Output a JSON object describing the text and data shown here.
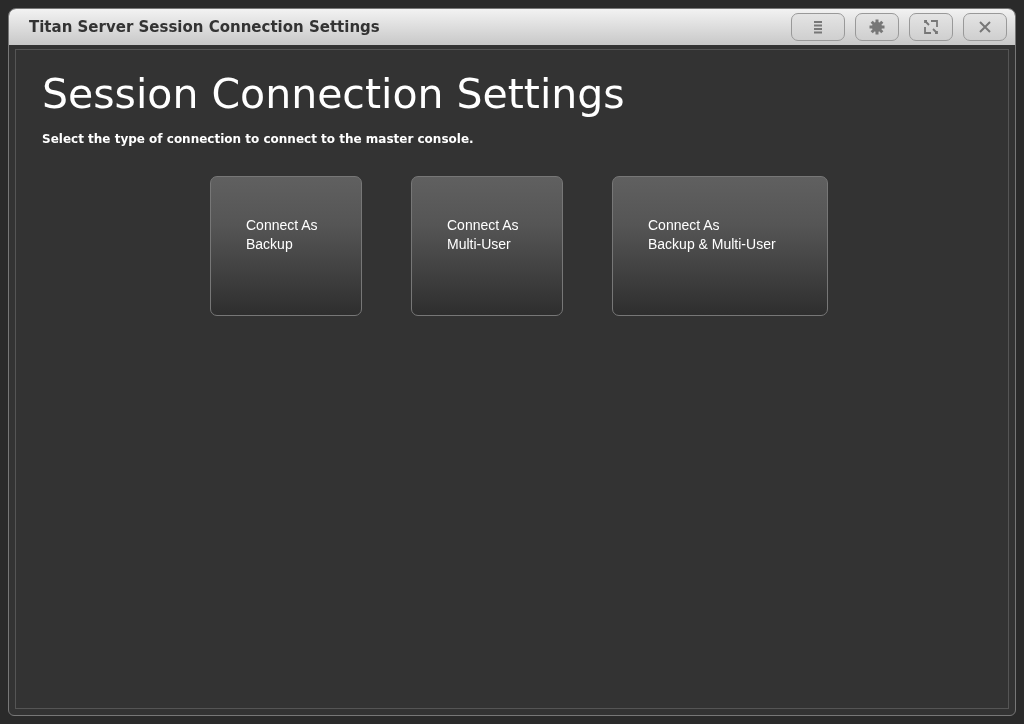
{
  "window": {
    "title": "Titan Server Session Connection Settings"
  },
  "heading": "Session Connection Settings",
  "instruction": "Select the type of connection to connect to the master console.",
  "buttons": [
    {
      "lines": [
        "Connect As",
        "Backup"
      ]
    },
    {
      "lines": [
        "Connect As",
        "Multi-User"
      ]
    },
    {
      "lines": [
        "Connect As",
        "Backup & Multi-User"
      ]
    }
  ]
}
